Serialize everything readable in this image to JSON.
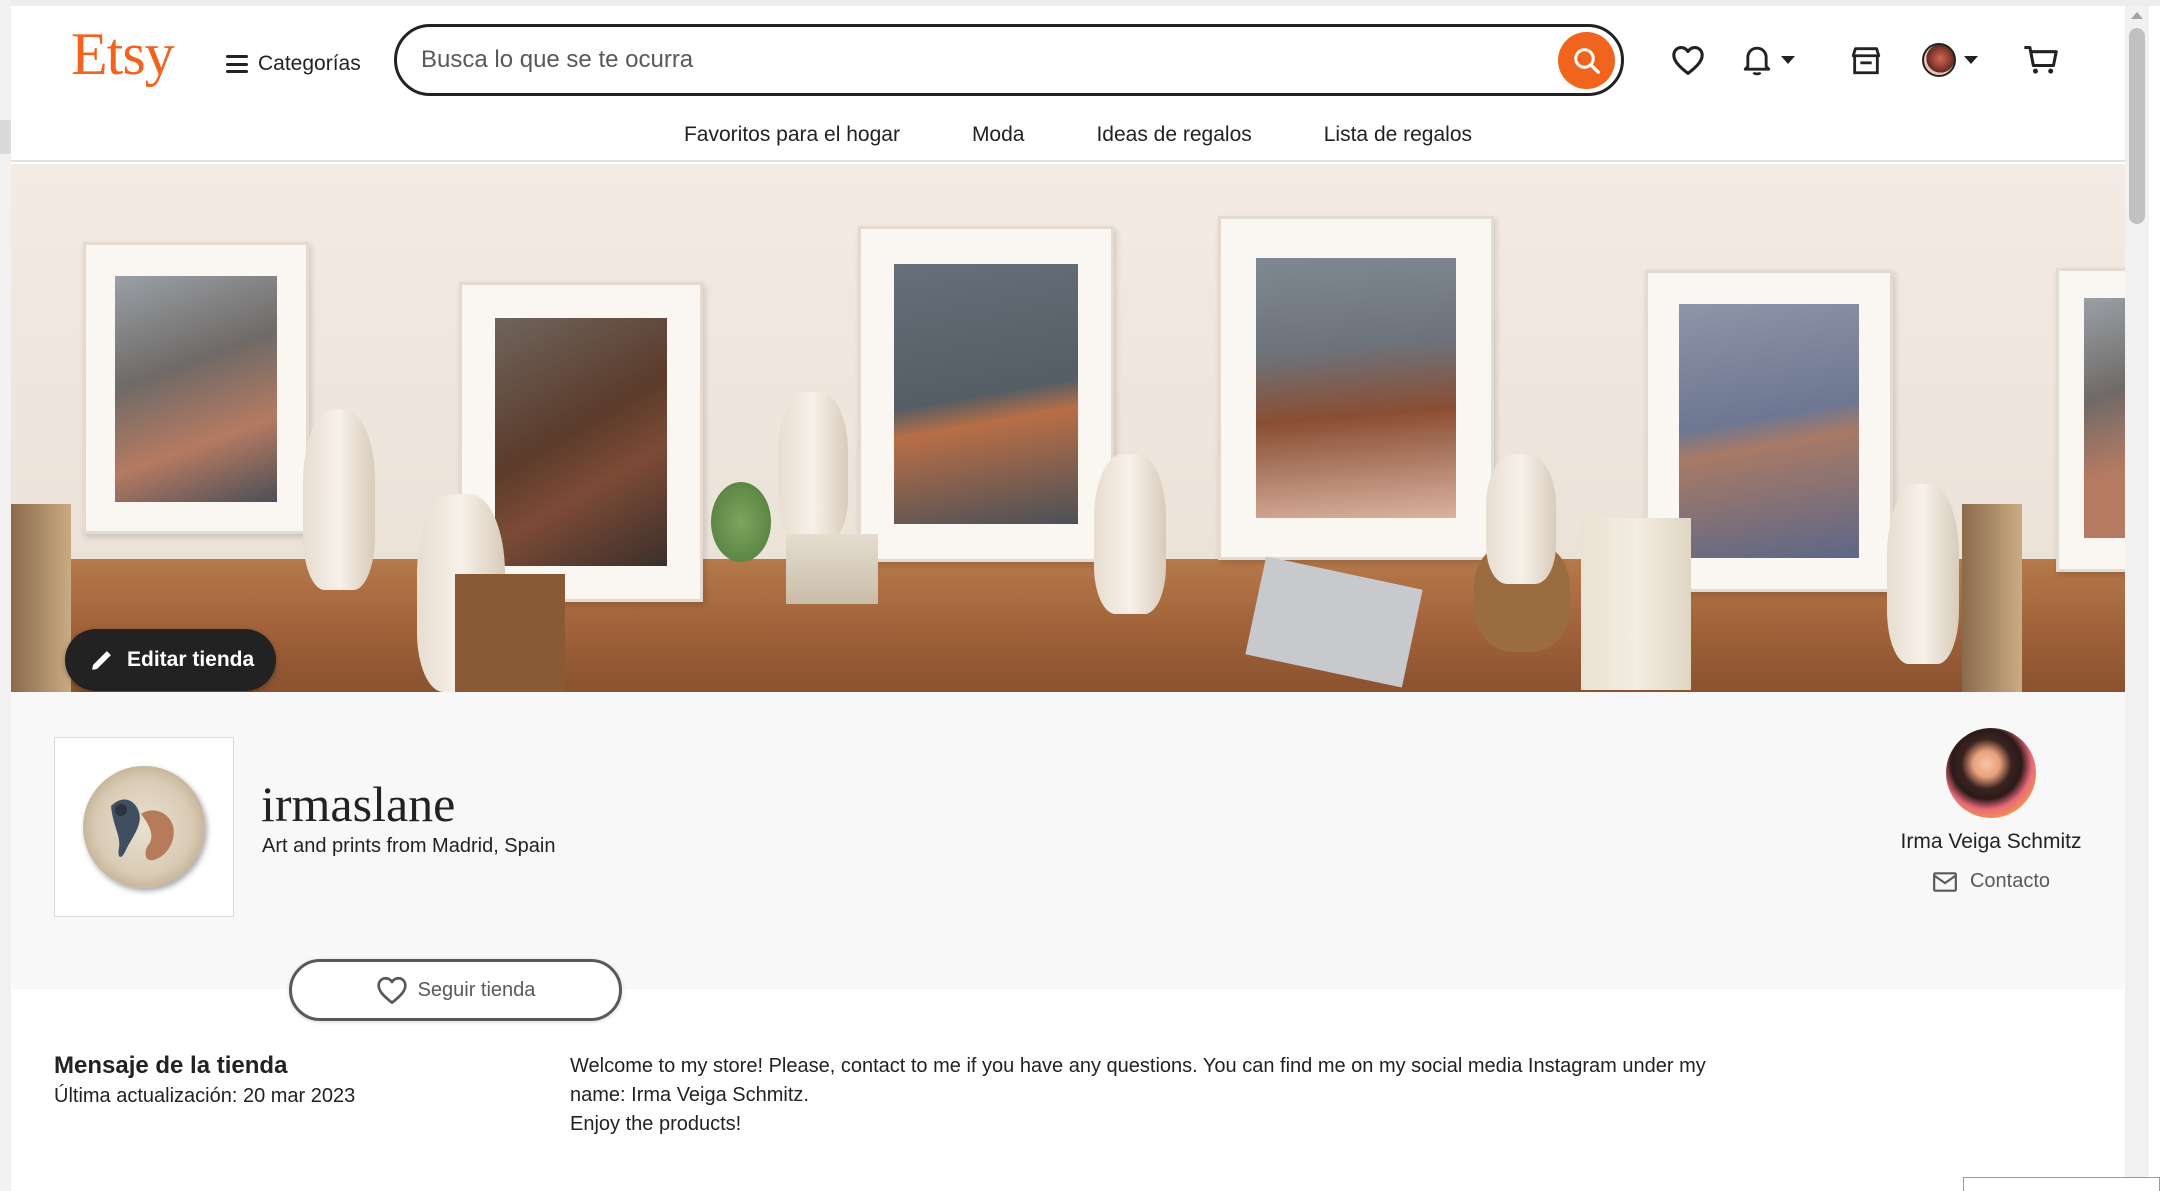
{
  "header": {
    "logo": "Etsy",
    "categories_label": "Categorías",
    "search_placeholder": "Busca lo que se te ocurra"
  },
  "nav": {
    "items": [
      "Favoritos para el hogar",
      "Moda",
      "Ideas de regalos",
      "Lista de regalos"
    ]
  },
  "banner": {
    "edit_store_label": "Editar tienda"
  },
  "shop": {
    "name": "irmaslane",
    "tagline": "Art and prints from Madrid, Spain",
    "follow_label": "Seguir tienda"
  },
  "owner": {
    "name": "Irma Veiga Schmitz",
    "contact_label": "Contacto"
  },
  "announcement": {
    "title": "Mensaje de la tienda",
    "updated": "Última actualización: 20 mar 2023",
    "line1": "Welcome to my store! Please, contact to me if you have any questions. You can find me on my social media Instagram under my",
    "line2": "name: Irma Veiga Schmitz.",
    "line3": "Enjoy the products!"
  },
  "colors": {
    "brand": "#f1641e",
    "text": "#222222",
    "muted": "#595959"
  }
}
